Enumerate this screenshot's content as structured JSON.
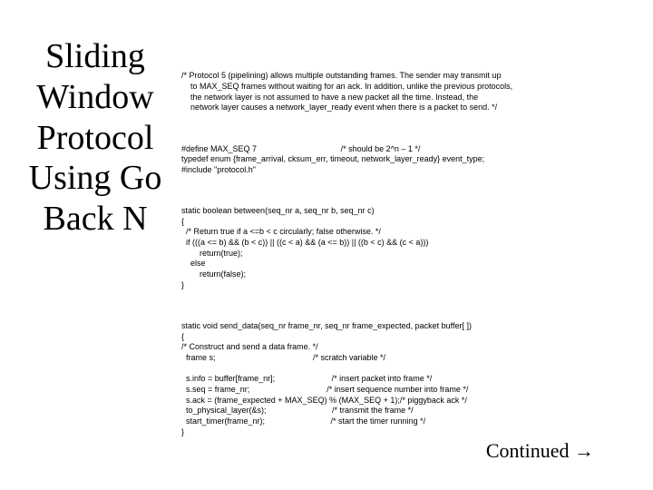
{
  "title": "Sliding Window Protocol Using Go Back N",
  "code": {
    "comment_header": "/* Protocol 5 (pipelining) allows multiple outstanding frames. The sender may transmit up\n    to MAX_SEQ frames without waiting for an ack. In addition, unlike the previous protocols,\n    the network layer is not assumed to have a new packet all the time. Instead, the\n    network layer causes a network_layer_ready event when there is a packet to send. */",
    "defines": "#define MAX_SEQ 7                                     /* should be 2^n – 1 */\ntypedef enum {frame_arrival, cksum_err, timeout, network_layer_ready} event_type;\n#include \"protocol.h\"",
    "between_fn": "static boolean between(seq_nr a, seq_nr b, seq_nr c)\n{\n  /* Return true if a <=b < c circularly; false otherwise. */\n  if (((a <= b) && (b < c)) || ((c < a) && (a <= b)) || ((b < c) && (c < a)))\n        return(true);\n    else\n        return(false);\n}",
    "send_data_fn": "static void send_data(seq_nr frame_nr, seq_nr frame_expected, packet buffer[ ])\n{\n/* Construct and send a data frame. */\n  frame s;                                           /* scratch variable */\n\n  s.info = buffer[frame_nr];                         /* insert packet into frame */\n  s.seq = frame_nr;                                  /* insert sequence number into frame */\n  s.ack = (frame_expected + MAX_SEQ) % (MAX_SEQ + 1);/* piggyback ack */\n  to_physical_layer(&s);                             /* transmit the frame */\n  start_timer(frame_nr);                             /* start the timer running */\n}"
  },
  "continued": "Continued →"
}
